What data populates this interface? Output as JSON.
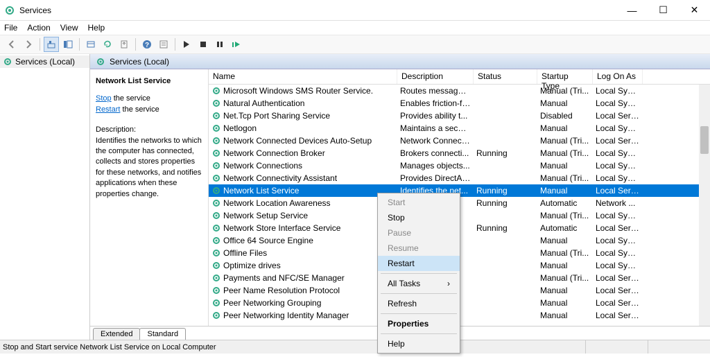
{
  "window": {
    "title": "Services",
    "minimize": "—",
    "maximize": "☐",
    "close": "✕"
  },
  "menu": [
    "File",
    "Action",
    "View",
    "Help"
  ],
  "toolbar_icons": [
    "back",
    "forward",
    "up",
    "show-hide",
    "explorer",
    "refresh",
    "export",
    "help",
    "props",
    "start",
    "stop",
    "pause",
    "restart"
  ],
  "tree": {
    "root": "Services (Local)"
  },
  "panel_header": "Services (Local)",
  "detail": {
    "selected_name": "Network List Service",
    "stop_link": "Stop",
    "stop_suffix": " the service",
    "restart_link": "Restart",
    "restart_suffix": " the service",
    "desc_label": "Description:",
    "desc_text": "Identifies the networks to which the computer has connected, collects and stores properties for these networks, and notifies applications when these properties change."
  },
  "columns": {
    "name": "Name",
    "description": "Description",
    "status": "Status",
    "startup": "Startup Type",
    "logon": "Log On As"
  },
  "rows": [
    {
      "name": "Microsoft Windows SMS Router Service.",
      "desc": "Routes messages...",
      "status": "",
      "startup": "Manual (Tri...",
      "logon": "Local Syst..."
    },
    {
      "name": "Natural Authentication",
      "desc": "Enables friction-fr...",
      "status": "",
      "startup": "Manual",
      "logon": "Local Syst..."
    },
    {
      "name": "Net.Tcp Port Sharing Service",
      "desc": "Provides ability t...",
      "status": "",
      "startup": "Disabled",
      "logon": "Local Serv..."
    },
    {
      "name": "Netlogon",
      "desc": "Maintains a secur...",
      "status": "",
      "startup": "Manual",
      "logon": "Local Syst..."
    },
    {
      "name": "Network Connected Devices Auto-Setup",
      "desc": "Network Connect...",
      "status": "",
      "startup": "Manual (Tri...",
      "logon": "Local Serv..."
    },
    {
      "name": "Network Connection Broker",
      "desc": "Brokers connecti...",
      "status": "Running",
      "startup": "Manual (Tri...",
      "logon": "Local Syst..."
    },
    {
      "name": "Network Connections",
      "desc": "Manages objects...",
      "status": "",
      "startup": "Manual",
      "logon": "Local Syst..."
    },
    {
      "name": "Network Connectivity Assistant",
      "desc": "Provides DirectAc...",
      "status": "",
      "startup": "Manual (Tri...",
      "logon": "Local Syst..."
    },
    {
      "name": "Network List Service",
      "desc": "Identifies the net...",
      "status": "Running",
      "startup": "Manual",
      "logon": "Local Serv...",
      "selected": true
    },
    {
      "name": "Network Location Awareness",
      "desc": "",
      "status": "Running",
      "startup": "Automatic",
      "logon": "Network ..."
    },
    {
      "name": "Network Setup Service",
      "desc": "u...",
      "status": "",
      "startup": "Manual (Tri...",
      "logon": "Local Syst..."
    },
    {
      "name": "Network Store Interface Service",
      "desc": "...",
      "status": "Running",
      "startup": "Automatic",
      "logon": "Local Serv..."
    },
    {
      "name": "Office 64 Source Engine",
      "desc": "...",
      "status": "",
      "startup": "Manual",
      "logon": "Local Syst..."
    },
    {
      "name": "Offline Files",
      "desc": "",
      "status": "",
      "startup": "Manual (Tri...",
      "logon": "Local Syst..."
    },
    {
      "name": "Optimize drives",
      "desc": "",
      "status": "",
      "startup": "Manual",
      "logon": "Local Syst..."
    },
    {
      "name": "Payments and NFC/SE Manager",
      "desc": "",
      "status": "",
      "startup": "Manual (Tri...",
      "logon": "Local Serv..."
    },
    {
      "name": "Peer Name Resolution Protocol",
      "desc": "",
      "status": "",
      "startup": "Manual",
      "logon": "Local Serv..."
    },
    {
      "name": "Peer Networking Grouping",
      "desc": "",
      "status": "",
      "startup": "Manual",
      "logon": "Local Serv..."
    },
    {
      "name": "Peer Networking Identity Manager",
      "desc": "",
      "status": "",
      "startup": "Manual",
      "logon": "Local Serv..."
    }
  ],
  "tabs": {
    "extended": "Extended",
    "standard": "Standard"
  },
  "statusbar": "Stop and Start service Network List Service on Local Computer",
  "context_menu": [
    {
      "label": "Start",
      "disabled": true
    },
    {
      "label": "Stop"
    },
    {
      "label": "Pause",
      "disabled": true
    },
    {
      "label": "Resume",
      "disabled": true
    },
    {
      "label": "Restart",
      "highlighted": true
    },
    {
      "sep": true
    },
    {
      "label": "All Tasks",
      "submenu": true
    },
    {
      "sep": true
    },
    {
      "label": "Refresh"
    },
    {
      "sep": true
    },
    {
      "label": "Properties",
      "bold": true
    },
    {
      "sep": true
    },
    {
      "label": "Help"
    }
  ]
}
